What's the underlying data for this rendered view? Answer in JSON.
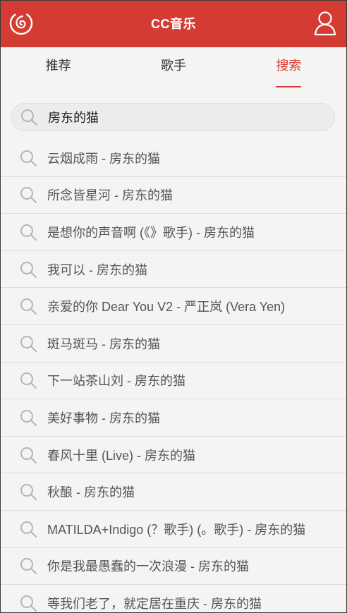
{
  "header": {
    "title": "CC音乐",
    "logo_icon": "netease-music-logo-icon",
    "user_icon": "user-icon",
    "brand_color": "#d43c33"
  },
  "tabs": [
    {
      "label": "推荐",
      "active": false
    },
    {
      "label": "歌手",
      "active": false
    },
    {
      "label": "搜索",
      "active": true
    }
  ],
  "search": {
    "value": "房东的猫",
    "icon": "search-icon"
  },
  "suggestions": [
    "云烟成雨 - 房东的猫",
    "所念皆星河 - 房东的猫",
    "是想你的声音啊 (《》歌手) - 房东的猫",
    "我可以 - 房东的猫",
    "亲爱的你 Dear You V2 - 严正岚 (Vera Yen)",
    "斑马斑马 - 房东的猫",
    "下一站茶山刘 - 房东的猫",
    "美好事物 - 房东的猫",
    "春风十里 (Live) - 房东的猫",
    "秋酿 - 房东的猫",
    "MATILDA+Indigo (？歌手) (。歌手) - 房东的猫",
    "你是我最愚蠢的一次浪漫 - 房东的猫",
    "等我们老了，就定居在重庆 - 房东的猫"
  ]
}
